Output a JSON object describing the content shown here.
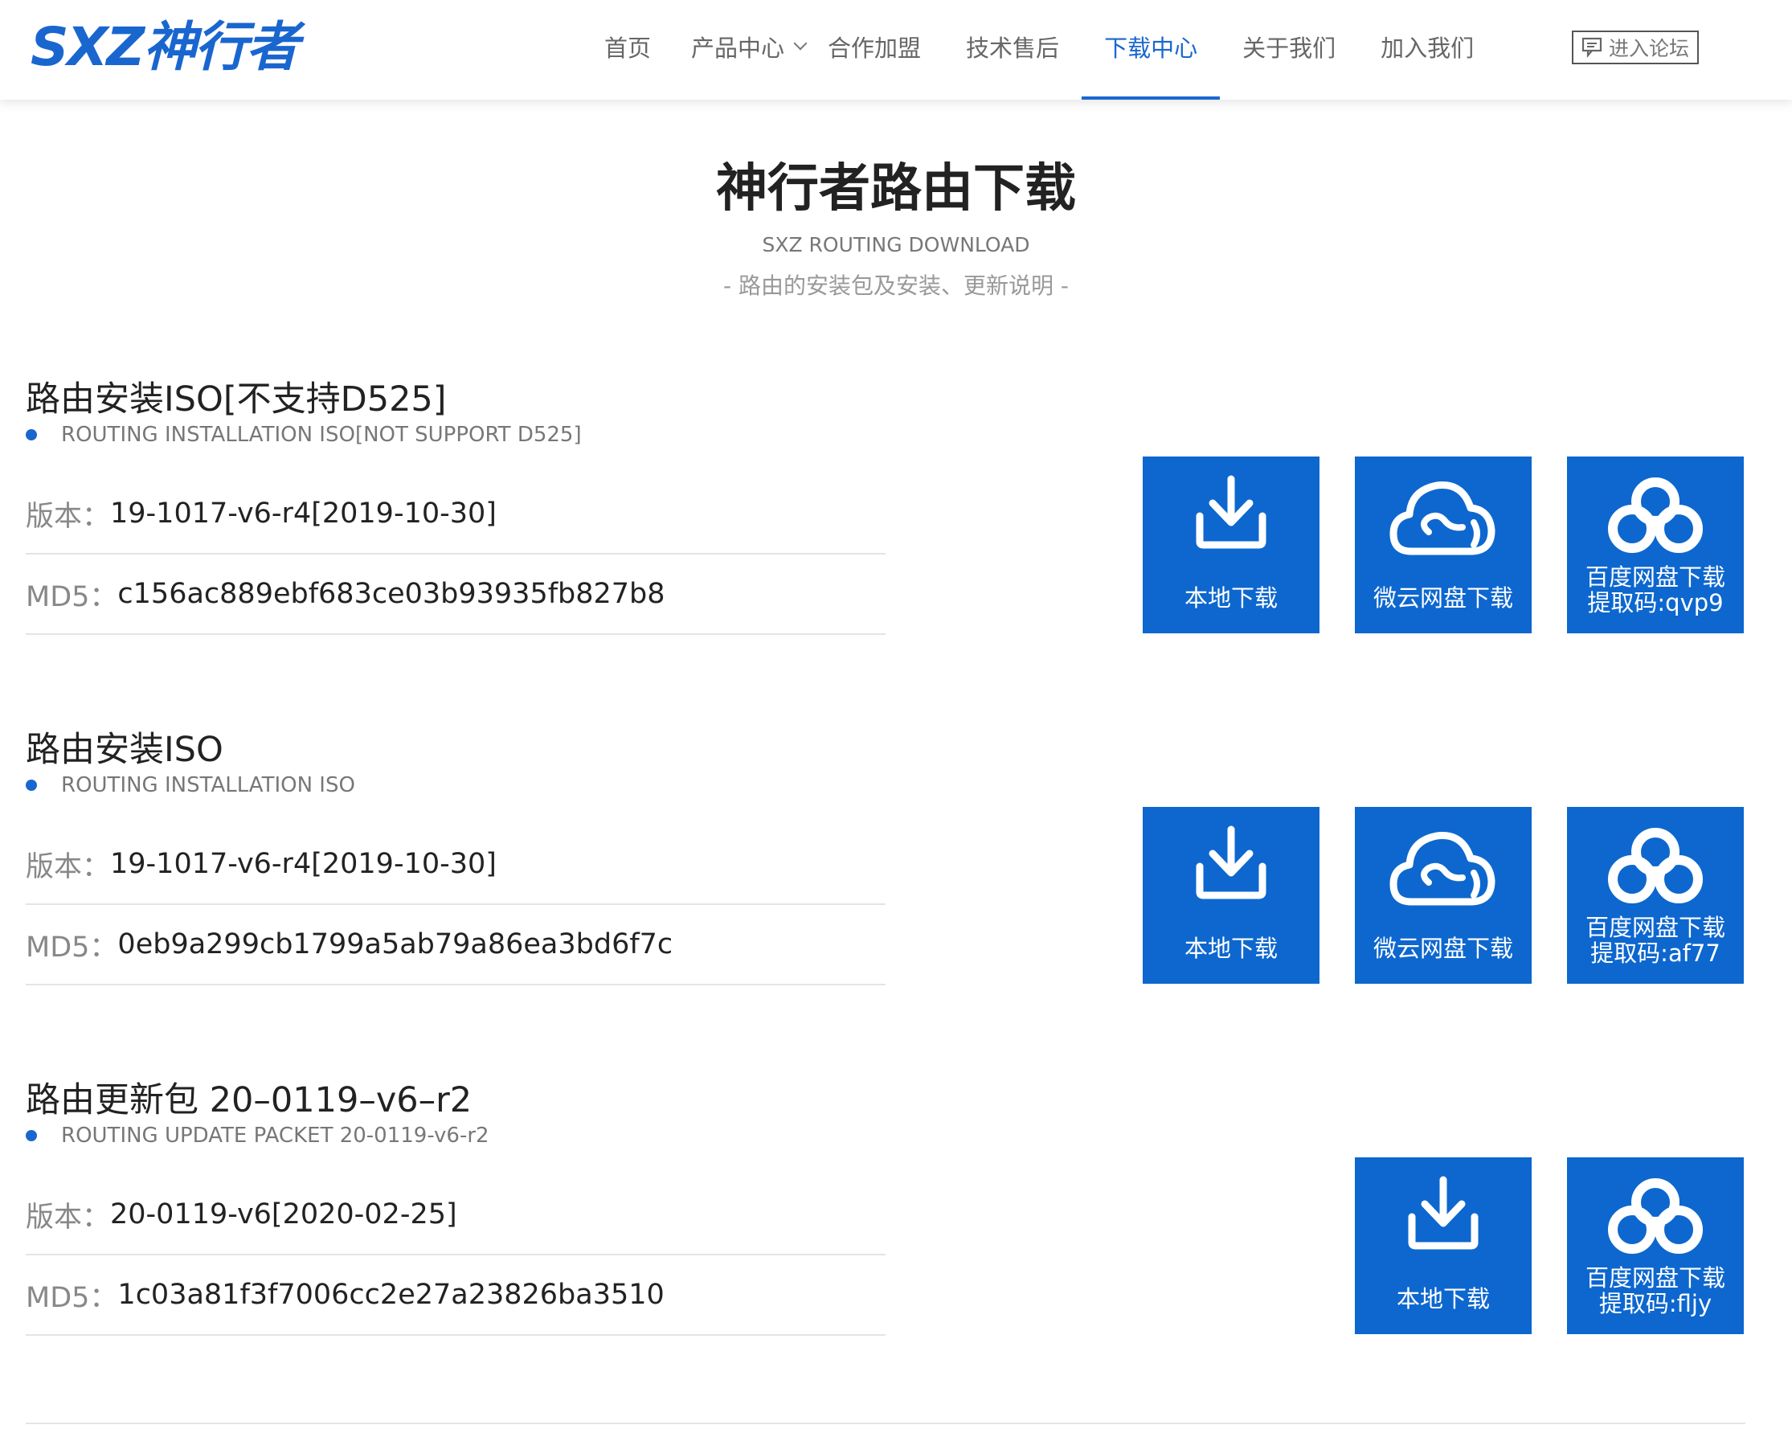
{
  "header": {
    "logo_text": "SXZ神行者",
    "nav": [
      {
        "label": "首页"
      },
      {
        "label": "产品中心"
      },
      {
        "label": "合作加盟"
      },
      {
        "label": "技术售后"
      },
      {
        "label": "下载中心"
      },
      {
        "label": "关于我们"
      },
      {
        "label": "加入我们"
      }
    ],
    "active_nav": "下载中心",
    "forum_label": "进入论坛"
  },
  "page": {
    "title": "神行者路由下载",
    "subtitle_en": "SXZ ROUTING DOWNLOAD",
    "subtitle_cn": "- 路由的安装包及安装、更新说明 -"
  },
  "labels": {
    "version": "版本：",
    "md5": "MD5："
  },
  "sections": [
    {
      "title": "路由安装ISO[不支持D525]",
      "subtitle": "ROUTING INSTALLATION ISO[NOT SUPPORT D525]",
      "version": "19-1017-v6-r4[2019-10-30]",
      "md5": "c156ac889ebf683ce03b93935fb827b8",
      "buttons": {
        "local": "本地下载",
        "weiyun": "微云网盘下载",
        "baidu_line1": "百度网盘下载",
        "baidu_line2": "提取码:qvp9"
      }
    },
    {
      "title": "路由安装ISO",
      "subtitle": "ROUTING INSTALLATION ISO",
      "version": "19-1017-v6-r4[2019-10-30]",
      "md5": "0eb9a299cb1799a5ab79a86ea3bd6f7c",
      "buttons": {
        "local": "本地下载",
        "weiyun": "微云网盘下载",
        "baidu_line1": "百度网盘下载",
        "baidu_line2": "提取码:af77"
      }
    },
    {
      "title": "路由更新包 20–0119–v6–r2",
      "subtitle": "ROUTING UPDATE PACKET 20-0119-v6-r2",
      "version": "20-0119-v6[2020-02-25]",
      "md5": "1c03a81f3f7006cc2e27a23826ba3510",
      "buttons": {
        "local": "本地下载",
        "baidu_line1": "百度网盘下载",
        "baidu_line2": "提取码:fljy"
      }
    }
  ],
  "colors": {
    "accent": "#1a66cf",
    "button_bg": "#0d67cf"
  },
  "icons": {
    "download": "download-icon",
    "weiyun": "cloud-icon",
    "baidu": "baidu-netdisk-icon",
    "forum": "forum-icon"
  }
}
